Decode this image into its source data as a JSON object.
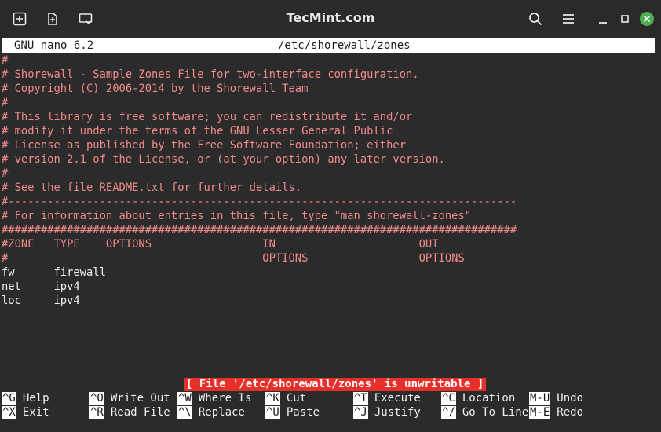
{
  "window": {
    "title": "TecMint.com"
  },
  "nano": {
    "version": "GNU nano 6.2",
    "filename": "/etc/shorewall/zones",
    "lines": [
      {
        "text": "#",
        "style": "comment"
      },
      {
        "text": "# Shorewall - Sample Zones File for two-interface configuration.",
        "style": "comment"
      },
      {
        "text": "# Copyright (C) 2006-2014 by the Shorewall Team",
        "style": "comment"
      },
      {
        "text": "#",
        "style": "comment"
      },
      {
        "text": "# This library is free software; you can redistribute it and/or",
        "style": "comment"
      },
      {
        "text": "# modify it under the terms of the GNU Lesser General Public",
        "style": "comment"
      },
      {
        "text": "# License as published by the Free Software Foundation; either",
        "style": "comment"
      },
      {
        "text": "# version 2.1 of the License, or (at your option) any later version.",
        "style": "comment"
      },
      {
        "text": "#",
        "style": "comment"
      },
      {
        "text": "# See the file README.txt for further details.",
        "style": "comment"
      },
      {
        "text": "#------------------------------------------------------------------------------",
        "style": "comment"
      },
      {
        "text": "# For information about entries in this file, type \"man shorewall-zones\"",
        "style": "comment"
      },
      {
        "text": "###############################################################################",
        "style": "comment"
      },
      {
        "text": "#ZONE   TYPE    OPTIONS                 IN                      OUT",
        "style": "comment"
      },
      {
        "text": "#                                       OPTIONS                 OPTIONS",
        "style": "comment"
      },
      {
        "text": "fw      firewall",
        "style": "plain"
      },
      {
        "text": "net     ipv4",
        "style": "plain"
      },
      {
        "text": "loc     ipv4",
        "style": "plain"
      }
    ],
    "status_message": "[ File '/etc/shorewall/zones' is unwritable ]",
    "shortcuts_row1": [
      {
        "key": "^G",
        "label": "Help"
      },
      {
        "key": "^O",
        "label": "Write Out"
      },
      {
        "key": "^W",
        "label": "Where Is"
      },
      {
        "key": "^K",
        "label": "Cut"
      },
      {
        "key": "^T",
        "label": "Execute"
      },
      {
        "key": "^C",
        "label": "Location"
      },
      {
        "key": "M-U",
        "label": "Undo"
      }
    ],
    "shortcuts_row2": [
      {
        "key": "^X",
        "label": "Exit"
      },
      {
        "key": "^R",
        "label": "Read File"
      },
      {
        "key": "^\\",
        "label": "Replace"
      },
      {
        "key": "^U",
        "label": "Paste"
      },
      {
        "key": "^J",
        "label": "Justify"
      },
      {
        "key": "^/",
        "label": "Go To Line"
      },
      {
        "key": "M-E",
        "label": "Redo"
      }
    ]
  },
  "colors": {
    "comment": "#f08a8a",
    "status_bg": "#e8302a",
    "close_button": "#4caf50"
  }
}
